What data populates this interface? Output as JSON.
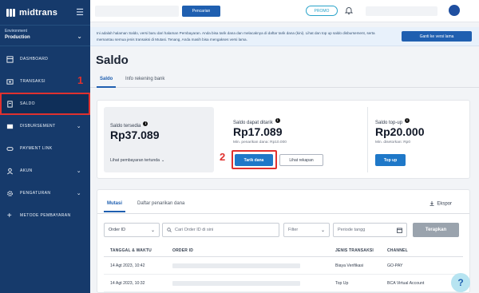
{
  "sidebar": {
    "logo": "midtrans",
    "environment_label": "Environment",
    "environment_value": "Production",
    "items": [
      {
        "label": "DASHBOARD",
        "icon": "dashboard-icon"
      },
      {
        "label": "TRANSAKSI",
        "icon": "transaction-icon"
      },
      {
        "label": "SALDO",
        "icon": "balance-icon"
      },
      {
        "label": "DISBURSEMENT",
        "icon": "disbursement-icon"
      },
      {
        "label": "PAYMENT LINK",
        "icon": "link-icon"
      },
      {
        "label": "AKUN",
        "icon": "user-icon"
      },
      {
        "label": "PENGATURAN",
        "icon": "gear-icon"
      },
      {
        "label": "METODE PEMBAYARAN",
        "icon": "plus-icon"
      }
    ],
    "annotation_number": "1"
  },
  "topbar": {
    "search_button": "Pencarian",
    "promo_label": "PROMO"
  },
  "notice": {
    "text": "Ini adalah halaman Saldo, versi baru dari halaman Pembayaran. Anda bisa tarik dana dan melacaknya di daftar tarik dana (kini). Lihat dan top up saldo disbursement, serta memantau semua jenis transaksi di Mutasi. Tenang, Anda masih bisa mengakses versi lama.",
    "button": "Ganti ke versi lama"
  },
  "page": {
    "title": "Saldo",
    "tabs": [
      "Saldo",
      "Info rekening bank"
    ]
  },
  "balances": {
    "available": {
      "label": "Saldo tersedia",
      "amount": "Rp37.089",
      "link": "Lihat pembayaran tertunda"
    },
    "withdrawable": {
      "label": "Saldo dapat ditarik",
      "amount": "Rp17.089",
      "sub": "Min. penarikan dana: Rp10.000",
      "primary_button": "Tarik dana",
      "secondary_button": "Lihat rekapan"
    },
    "topup": {
      "label": "Saldo top-up",
      "amount": "Rp20.000",
      "sub": "Min. disetorkan: Rp0",
      "button": "Top up"
    },
    "annotation_number": "2"
  },
  "mutasi": {
    "tabs": [
      "Mutasi",
      "Daftar penarikan dana"
    ],
    "export": "Ekspor",
    "filters": {
      "order_id_select": "Order ID",
      "search_placeholder": "Cari Order ID di sini",
      "filter_select": "Filter",
      "period_placeholder": "Periode tangg",
      "apply_button": "Terapkan"
    },
    "columns": [
      "TANGGAL & WAKTU",
      "ORDER ID",
      "JENIS TRANSAKSI",
      "CHANNEL"
    ],
    "rows": [
      {
        "datetime": "14 Agt 2023, 10:42",
        "type": "Biaya Verifikasi",
        "channel": "GO-PAY"
      },
      {
        "datetime": "14 Agt 2023, 10:32",
        "type": "Top Up",
        "channel": "BCA Virtual Account"
      }
    ]
  },
  "help_label": "?"
}
